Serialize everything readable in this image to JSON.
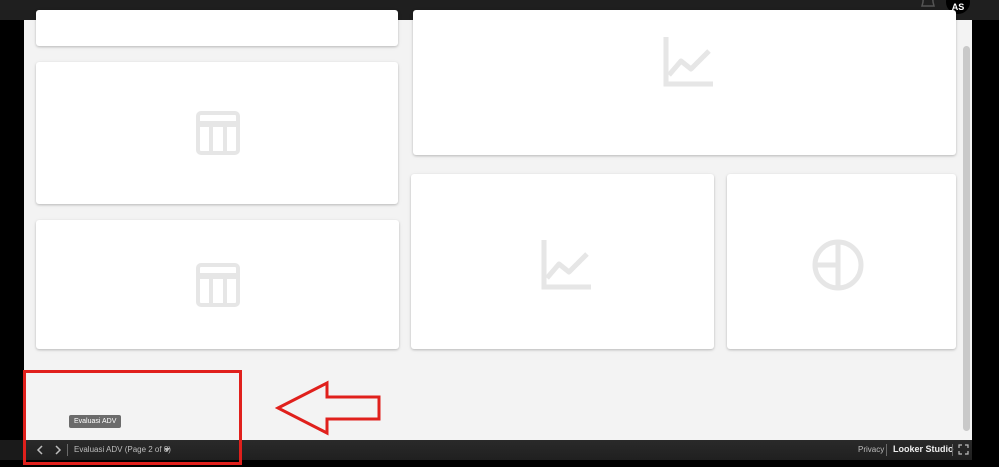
{
  "header": {
    "avatar_text": "AS",
    "bell_icon": "bell-icon"
  },
  "cards": [
    {
      "id": "card-top-left-partial",
      "icon": "none"
    },
    {
      "id": "card-table-1",
      "icon": "table-icon"
    },
    {
      "id": "card-line-chart-1",
      "icon": "line-chart-icon"
    },
    {
      "id": "card-table-2",
      "icon": "table-icon"
    },
    {
      "id": "card-line-chart-2",
      "icon": "line-chart-icon"
    },
    {
      "id": "card-pie-chart",
      "icon": "pie-chart-icon"
    }
  ],
  "tooltip": {
    "text": "Evaluasi ADV"
  },
  "footer": {
    "page_label": "Evaluasi ADV (Page 2 of 8)",
    "privacy_label": "Privacy",
    "brand_label": "Looker Studio"
  },
  "colors": {
    "canvas_bg": "#f3f3f3",
    "placeholder_icon": "#e6e6e6",
    "annotation_red": "#e0201c"
  }
}
